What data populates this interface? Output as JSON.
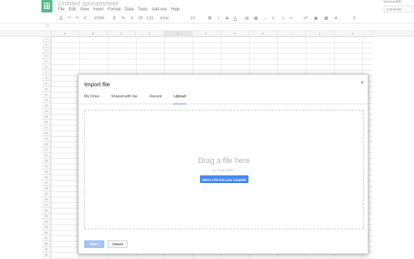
{
  "app": {
    "title": "Untitled spreadsheet",
    "menu": [
      "File",
      "Edit",
      "View",
      "Insert",
      "Format",
      "Data",
      "Tools",
      "Add-ons",
      "Help"
    ],
    "account": "kmoore@th",
    "comments_label": "Comments"
  },
  "toolbar": {
    "zoom": "100%",
    "currency": "$",
    "percent": "%",
    "decimal_less": ".0",
    "decimal_more": ".00",
    "number_format": "123",
    "font": "Arial",
    "font_size": "10",
    "bold": "B",
    "italic": "I",
    "strike": "S",
    "text_color": "A"
  },
  "formula_bar": {
    "fx": "fx"
  },
  "grid": {
    "columns": [
      "A",
      "B",
      "C",
      "D",
      "E",
      "F",
      "G",
      "H",
      "I",
      "J",
      "K"
    ],
    "rows": [
      "1",
      "2",
      "3",
      "4",
      "5",
      "6",
      "7",
      "8",
      "9",
      "10",
      "11",
      "12",
      "13",
      "14",
      "15",
      "16",
      "17",
      "18",
      "19",
      "20",
      "21",
      "22",
      "23",
      "24",
      "25",
      "26",
      "27",
      "28",
      "29",
      "30",
      "31",
      "32",
      "33",
      "34",
      "35",
      "36",
      "37",
      "38",
      "39",
      "40"
    ],
    "selected_column": "E"
  },
  "dialog": {
    "title": "Import file",
    "close": "×",
    "tabs": [
      {
        "label": "My Drive"
      },
      {
        "label": "Shared with me"
      },
      {
        "label": "Recent"
      },
      {
        "label": "Upload",
        "active": true
      }
    ],
    "drag_text": "Drag a file here",
    "or_text": "Or, if you prefer...",
    "select_file_label": "Select a file from your computer",
    "select_label": "Select",
    "cancel_label": "Cancel"
  },
  "colors": {
    "sheets_green": "#21a464",
    "accent_blue": "#4a8bf5",
    "disabled_blue": "#a7c4f5"
  }
}
